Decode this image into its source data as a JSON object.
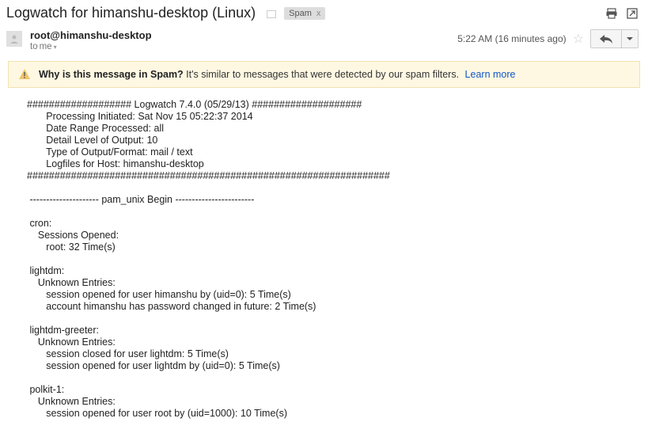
{
  "header": {
    "subject": "Logwatch for himanshu-desktop (Linux)",
    "spam_label": "Spam",
    "spam_x": "x"
  },
  "sender": {
    "name": "root@himanshu-desktop",
    "to_prefix": "to ",
    "to_value": "me",
    "timestamp": "5:22 AM (16 minutes ago)"
  },
  "spam_banner": {
    "question": "Why is this message in Spam?",
    "reason": " It's similar to messages that were detected by our spam filters.  ",
    "learn_more": "Learn more"
  },
  "body": "################### Logwatch 7.4.0 (05/29/13) ####################\n       Processing Initiated: Sat Nov 15 05:22:37 2014\n       Date Range Processed: all\n       Detail Level of Output: 10\n       Type of Output/Format: mail / text\n       Logfiles for Host: himanshu-desktop\n##################################################################\n \n --------------------- pam_unix Begin ------------------------\n \n cron:\n    Sessions Opened:\n       root: 32 Time(s)\n \n lightdm:\n    Unknown Entries:\n       session opened for user himanshu by (uid=0): 5 Time(s)\n       account himanshu has password changed in future: 2 Time(s)\n \n lightdm-greeter:\n    Unknown Entries:\n       session closed for user lightdm: 5 Time(s)\n       session opened for user lightdm by (uid=0): 5 Time(s)\n \n polkit-1:\n    Unknown Entries:\n       session opened for user root by (uid=1000): 10 Time(s)"
}
